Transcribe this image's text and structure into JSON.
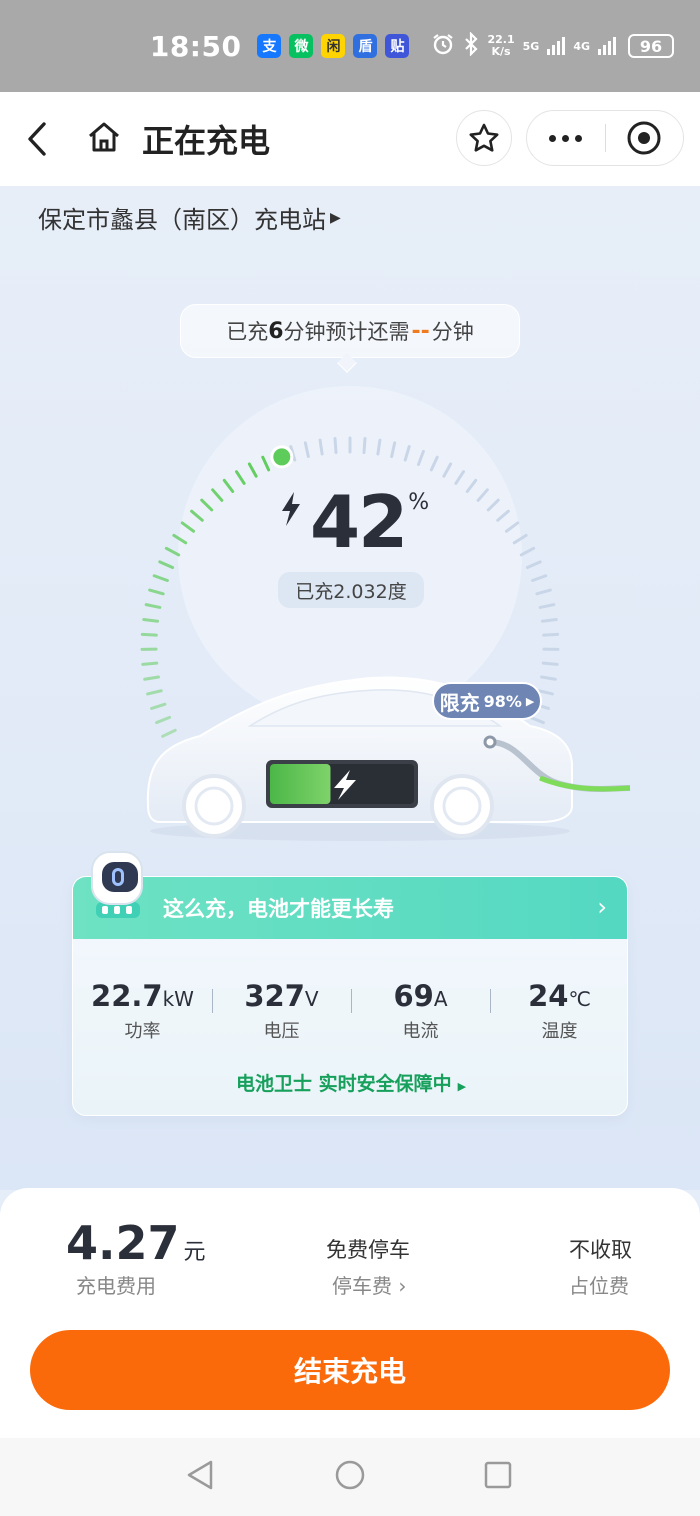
{
  "status_bar": {
    "time": "18:50",
    "app_badges": [
      {
        "icon": "alipay-icon",
        "glyph": "支",
        "color": "#1677ff"
      },
      {
        "icon": "wechat-icon",
        "glyph": "微",
        "color": "#07c160"
      },
      {
        "icon": "xianyu-icon",
        "glyph": "闲",
        "color": "#ffd400"
      },
      {
        "icon": "shield-app-icon",
        "glyph": "盾",
        "color": "#2f6fe0"
      },
      {
        "icon": "tieba-icon",
        "glyph": "贴",
        "color": "#3f56d9"
      }
    ],
    "net_speed_value": "22.1",
    "net_speed_unit": "K/s",
    "signal_1": "5G",
    "signal_2": "4G",
    "battery": "96"
  },
  "nav": {
    "title": "正在充电"
  },
  "station": {
    "name": "保定市蠡县（南区）充电站"
  },
  "charge_time": {
    "prefix": "已充",
    "minutes": "6",
    "middle": "分钟预计还需",
    "remaining": "--",
    "suffix": "分钟"
  },
  "gauge": {
    "percent": 42,
    "percent_text": "42",
    "percent_sign": "%",
    "energy_text": "已充2.032度",
    "active_color": "#5dcc5a"
  },
  "limit": {
    "label": "限充",
    "value": "98%"
  },
  "tips_card": {
    "title": "这么充，电池才能更长寿",
    "metrics": [
      {
        "value": "22.7",
        "unit": "kW",
        "label": "功率"
      },
      {
        "value": "327",
        "unit": "V",
        "label": "电压"
      },
      {
        "value": "69",
        "unit": "A",
        "label": "电流"
      },
      {
        "value": "24",
        "unit": "℃",
        "label": "温度"
      }
    ],
    "guard_text": "电池卫士 实时安全保障中"
  },
  "bottom": {
    "fee_amount": "4.27",
    "fee_unit": "元",
    "fee_label": "充电费用",
    "parking_title": "免费停车",
    "parking_link": "停车费 ›",
    "occupancy_title": "不收取",
    "occupancy_label": "占位费",
    "end_button": "结束充电",
    "accent_color": "#fb6a0a"
  }
}
